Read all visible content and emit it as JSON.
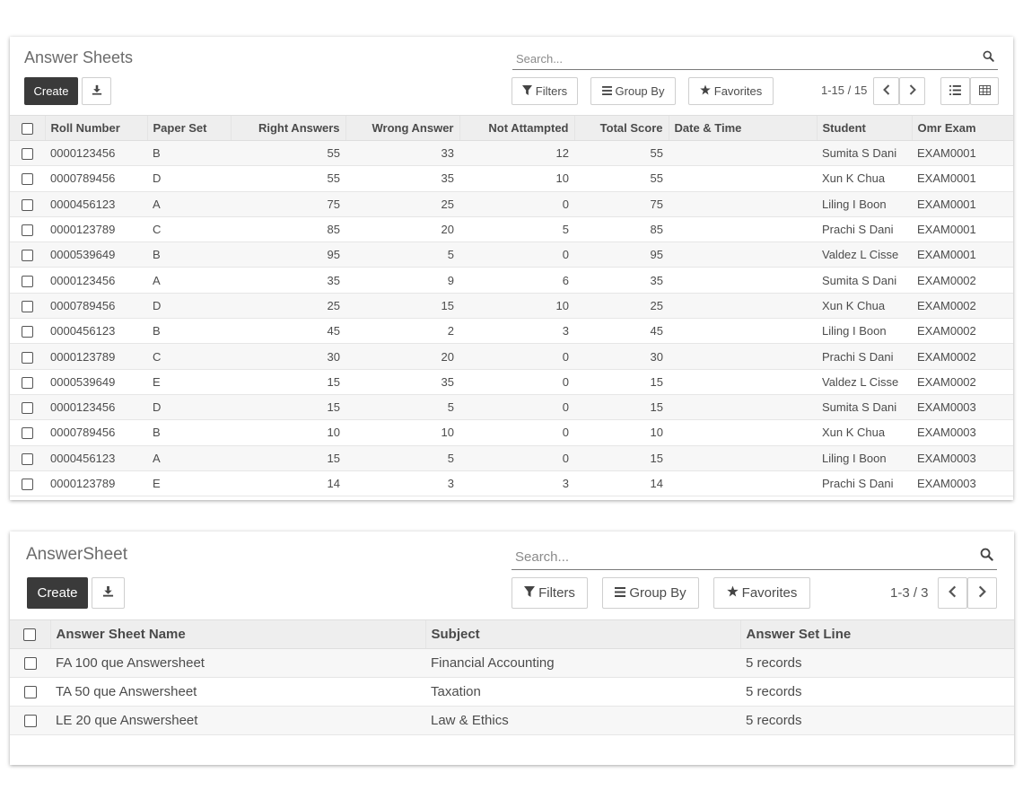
{
  "panel1": {
    "title": "Answer Sheets",
    "search_placeholder": "Search...",
    "create_label": "Create",
    "filters_label": "Filters",
    "groupby_label": "Group By",
    "favorites_label": "Favorites",
    "pager": "1-15 / 15",
    "columns": [
      "Roll Number",
      "Paper Set",
      "Right Answers",
      "Wrong Answer",
      "Not Attampted",
      "Total Score",
      "Date & Time",
      "Student",
      "Omr Exam"
    ],
    "rows": [
      [
        "0000123456",
        "B",
        "55",
        "33",
        "12",
        "55",
        "",
        "Sumita S Dani",
        "EXAM0001"
      ],
      [
        "0000789456",
        "D",
        "55",
        "35",
        "10",
        "55",
        "",
        "Xun K Chua",
        "EXAM0001"
      ],
      [
        "0000456123",
        "A",
        "75",
        "25",
        "0",
        "75",
        "",
        "Liling I Boon",
        "EXAM0001"
      ],
      [
        "0000123789",
        "C",
        "85",
        "20",
        "5",
        "85",
        "",
        "Prachi S Dani",
        "EXAM0001"
      ],
      [
        "0000539649",
        "B",
        "95",
        "5",
        "0",
        "95",
        "",
        "Valdez L Cisse",
        "EXAM0001"
      ],
      [
        "0000123456",
        "A",
        "35",
        "9",
        "6",
        "35",
        "",
        "Sumita S Dani",
        "EXAM0002"
      ],
      [
        "0000789456",
        "D",
        "25",
        "15",
        "10",
        "25",
        "",
        "Xun K Chua",
        "EXAM0002"
      ],
      [
        "0000456123",
        "B",
        "45",
        "2",
        "3",
        "45",
        "",
        "Liling I Boon",
        "EXAM0002"
      ],
      [
        "0000123789",
        "C",
        "30",
        "20",
        "0",
        "30",
        "",
        "Prachi S Dani",
        "EXAM0002"
      ],
      [
        "0000539649",
        "E",
        "15",
        "35",
        "0",
        "15",
        "",
        "Valdez L Cisse",
        "EXAM0002"
      ],
      [
        "0000123456",
        "D",
        "15",
        "5",
        "0",
        "15",
        "",
        "Sumita S Dani",
        "EXAM0003"
      ],
      [
        "0000789456",
        "B",
        "10",
        "10",
        "0",
        "10",
        "",
        "Xun K Chua",
        "EXAM0003"
      ],
      [
        "0000456123",
        "A",
        "15",
        "5",
        "0",
        "15",
        "",
        "Liling I Boon",
        "EXAM0003"
      ],
      [
        "0000123789",
        "E",
        "14",
        "3",
        "3",
        "14",
        "",
        "Prachi S Dani",
        "EXAM0003"
      ]
    ]
  },
  "panel2": {
    "title": "AnswerSheet",
    "search_placeholder": "Search...",
    "create_label": "Create",
    "filters_label": "Filters",
    "groupby_label": "Group By",
    "favorites_label": "Favorites",
    "pager": "1-3 / 3",
    "columns": [
      "Answer Sheet Name",
      "Subject",
      "Answer Set Line"
    ],
    "rows": [
      [
        "FA 100 que Answersheet",
        "Financial Accounting",
        "5 records"
      ],
      [
        "TA 50 que Answersheet",
        "Taxation",
        "5 records"
      ],
      [
        "LE 20 que Answersheet",
        "Law & Ethics",
        "5 records"
      ]
    ]
  }
}
